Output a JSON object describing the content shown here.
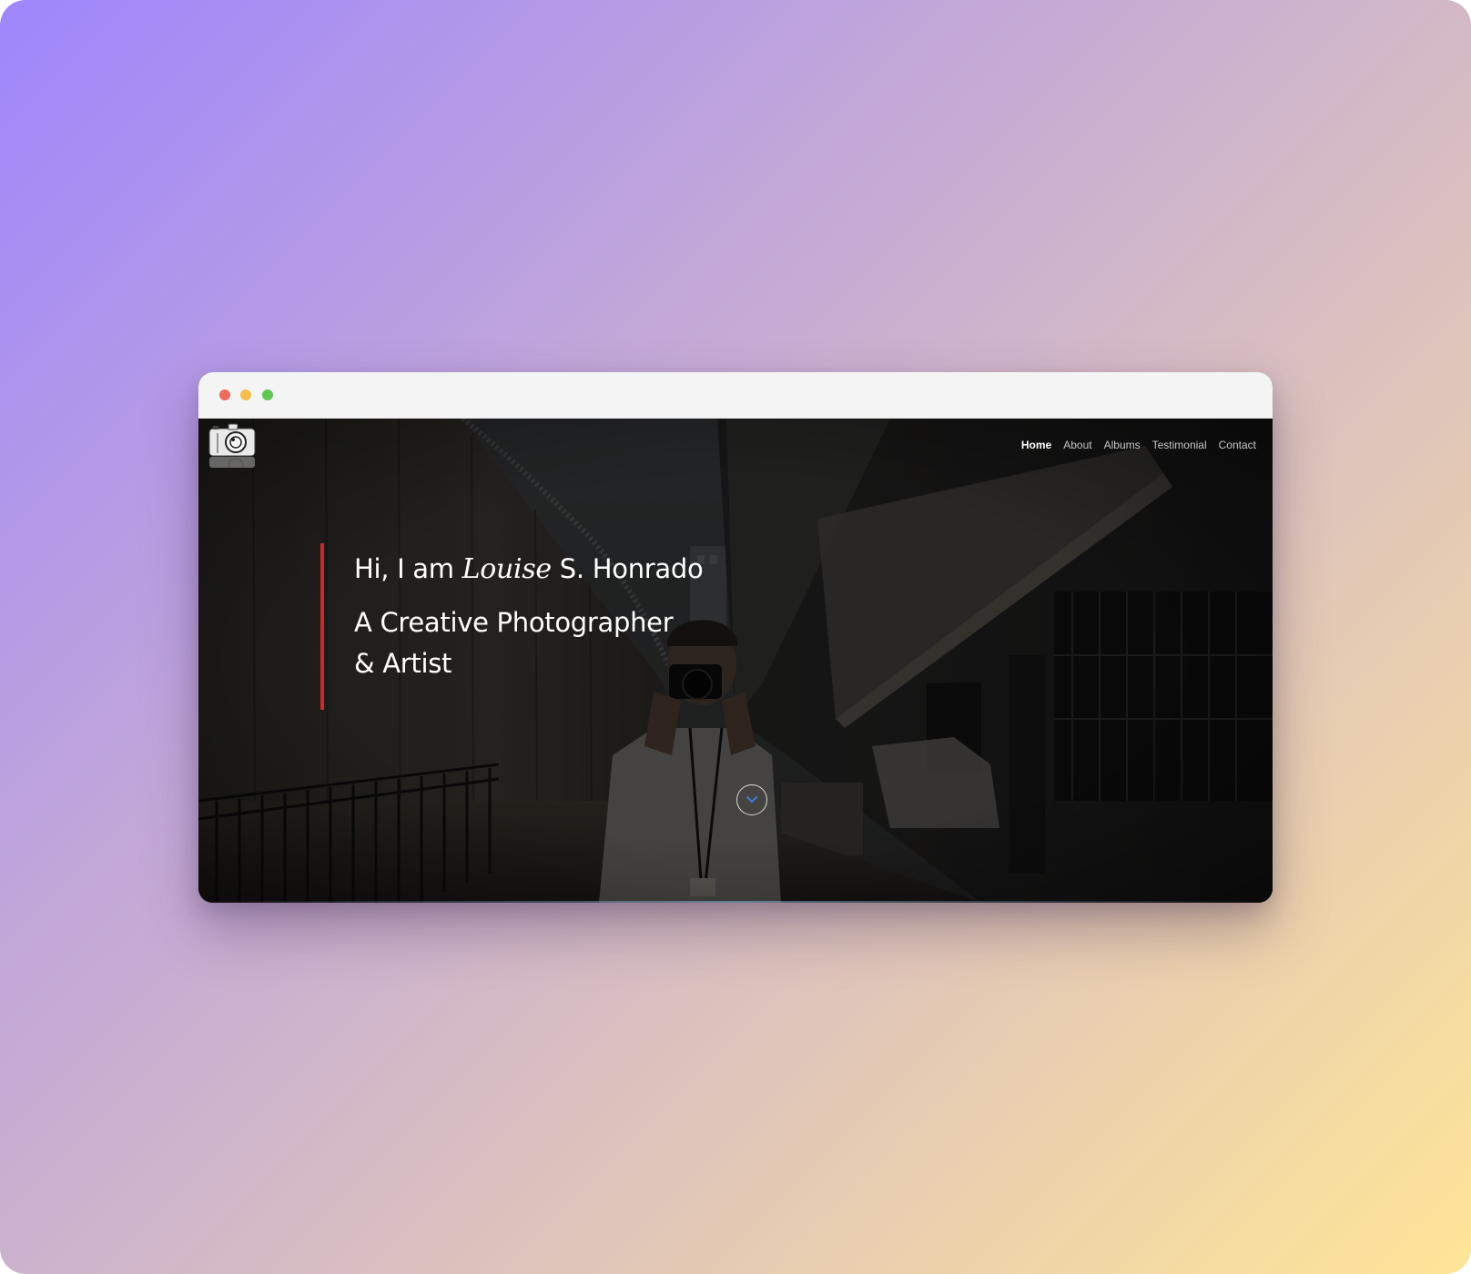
{
  "logo": {
    "icon": "camera-icon"
  },
  "nav": {
    "items": [
      {
        "label": "Home",
        "active": true
      },
      {
        "label": "About",
        "active": false
      },
      {
        "label": "Albums",
        "active": false
      },
      {
        "label": "Testimonial",
        "active": false
      },
      {
        "label": "Contact",
        "active": false
      }
    ]
  },
  "hero": {
    "greeting": "Hi, I am",
    "first_name": "Louise",
    "last_name": "S. Honrado",
    "tagline_1": "A Creative Photographer",
    "tagline_2": "& Artist",
    "scroll_icon": "chevron-down-icon"
  },
  "colors": {
    "accent": "#c62a2a",
    "scroll_chevron": "#3d7ed6",
    "nav_active": "#ffffff",
    "nav_inactive": "#c8c8c8"
  }
}
